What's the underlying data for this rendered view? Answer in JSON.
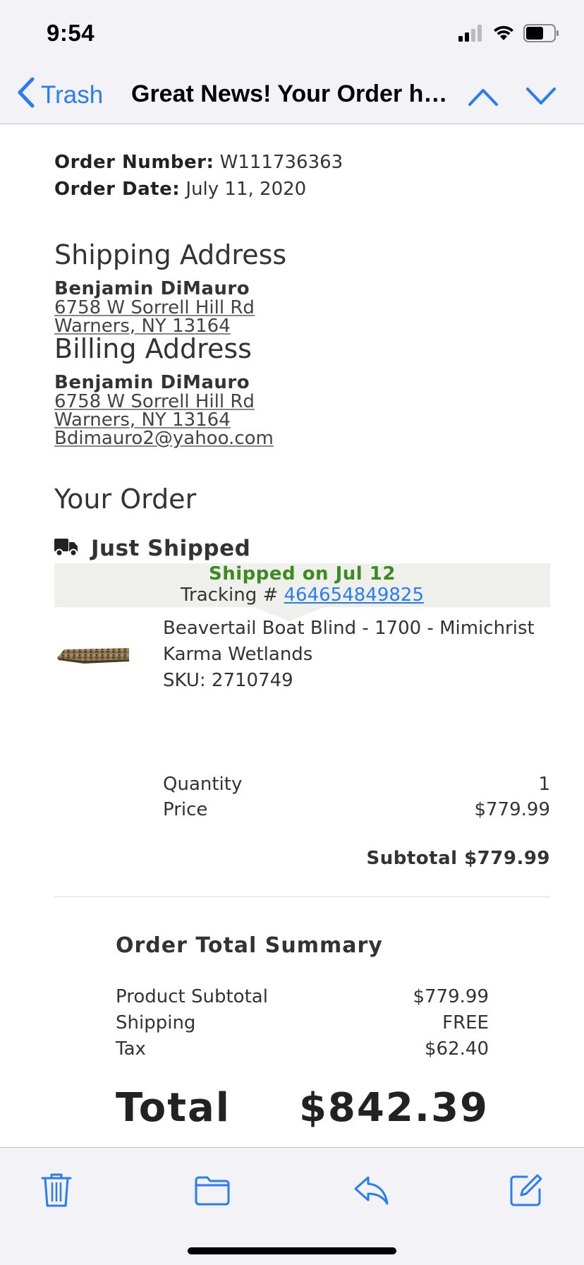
{
  "status_bar": {
    "time": "9:54"
  },
  "nav": {
    "back_label": "Trash",
    "title": "Great News! Your Order ha..."
  },
  "order": {
    "number_label": "Order Number:",
    "number_value": "W111736363",
    "date_label": "Order Date:",
    "date_value": "July 11, 2020"
  },
  "shipping_address": {
    "heading": "Shipping Address",
    "name": "Benjamin DiMauro",
    "line1": "6758 W Sorrell Hill Rd",
    "line2": "Warners, NY 13164"
  },
  "billing_address": {
    "heading": "Billing Address",
    "name": "Benjamin DiMauro",
    "line1": "6758 W Sorrell Hill Rd",
    "line2": "Warners, NY 13164",
    "email": "Bdimauro2@yahoo.com"
  },
  "your_order": {
    "heading": "Your Order",
    "status": "Just Shipped",
    "shipped_on": "Shipped on Jul 12",
    "tracking_label": "Tracking #",
    "tracking_number": "464654849825"
  },
  "product": {
    "name": "Beavertail Boat Blind - 1700 - Mimichrist",
    "variant": "Karma Wetlands",
    "sku": "SKU: 2710749",
    "quantity_label": "Quantity",
    "quantity_value": "1",
    "price_label": "Price",
    "price_value": "$779.99",
    "subtotal": "Subtotal $779.99"
  },
  "summary": {
    "heading": "Order Total Summary",
    "rows": [
      {
        "label": "Product Subtotal",
        "value": "$779.99"
      },
      {
        "label": "Shipping",
        "value": "FREE"
      },
      {
        "label": "Tax",
        "value": "$62.40"
      }
    ],
    "total_label": "Total",
    "total_value": "$842.39"
  },
  "colors": {
    "accent": "#2a7cf6",
    "shipped_green": "#3c8a20",
    "bar_bg": "#f2f2f7"
  },
  "toolbar": {
    "icons": [
      "trash-icon",
      "folder-icon",
      "reply-icon",
      "compose-icon"
    ]
  }
}
